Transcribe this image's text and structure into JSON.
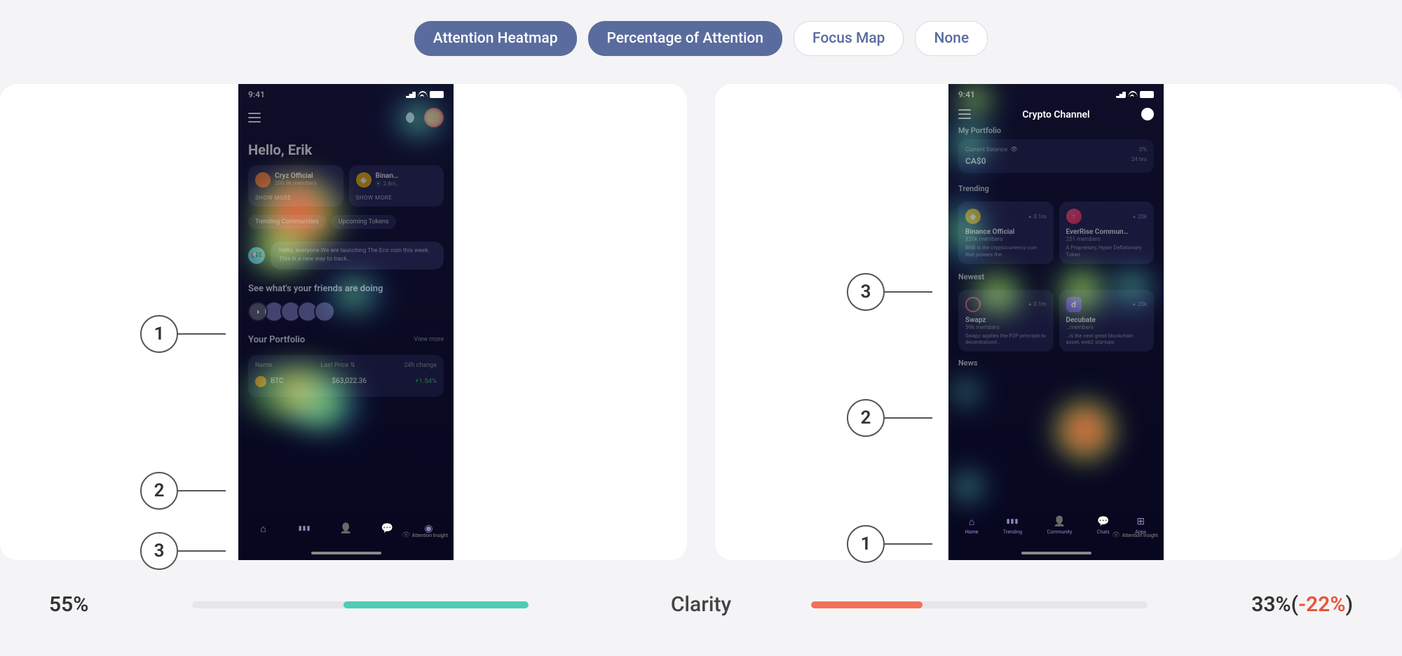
{
  "filters": {
    "heatmap": "Attention Heatmap",
    "percentage": "Percentage of Attention",
    "focusmap": "Focus Map",
    "none": "None"
  },
  "phoneA": {
    "time": "9:41",
    "greeting": "Hello, Erik",
    "card1_title": "Cryz Official",
    "card1_sub": "200.9k members",
    "card2_title": "Binan…",
    "card2_sub": "2.8m…",
    "show_more": "SHOW MORE",
    "tab1": "Trending Communities",
    "tab2": "Upcoming Tokens",
    "msg": "Hello, everyone.We are launching The Eco coin this week. This is a new way to track…",
    "friends_h": "See what's your friends are doing",
    "pf_title": "Your Portfolio",
    "view_more": "View more",
    "col_name": "Name",
    "col_price": "Last Price",
    "col_change": "24h change",
    "coin1": "BTC",
    "coin1_price": "$63,022.36",
    "coin1_change": "+1.54%",
    "watermark": "Attention Insight"
  },
  "phoneB": {
    "time": "9:41",
    "title": "Crypto Channel",
    "mp_h": "My Portfolio",
    "mp_bal_label": "Current Balance",
    "mp_bal": "CA$0",
    "mp_pct": "0%",
    "mp_hrs": "24 hrs",
    "trend_h": "Trending",
    "t1_title": "Binance Official",
    "t1_sub": "820k members",
    "t1_desc": "BNB is the cryptocurrency coin that powers the…",
    "t1_stat": "0.1m",
    "t2_title": "EverRise Commun…",
    "t2_sub": "251 members",
    "t2_desc": "A Proprietary, Hyper Deflationary Token",
    "t2_stat": "20k",
    "new_h": "Newest",
    "n1_title": "Swapz",
    "n1_sub": "59k members",
    "n1_desc": "Swapz applies the P2P principle to decentralized…",
    "n1_stat": "0.1m",
    "n2_title": "Decubate",
    "n2_sub": "…members",
    "n2_desc": "…is the next great blockchain asset, web2 startups",
    "n2_stat": "20k",
    "news_h": "News",
    "nav_home": "Home",
    "nav_trend": "Trending",
    "nav_comm": "Community",
    "nav_chats": "Chats",
    "nav_apps": "Apps",
    "watermark": "Attention Insight"
  },
  "markers": {
    "m1": "1",
    "m2": "2",
    "m3": "3"
  },
  "clarity": {
    "left_score": "55%",
    "label": "Clarity",
    "right_score": "33%",
    "right_delta_open": "(",
    "right_delta": "-22%",
    "right_delta_close": ")"
  }
}
